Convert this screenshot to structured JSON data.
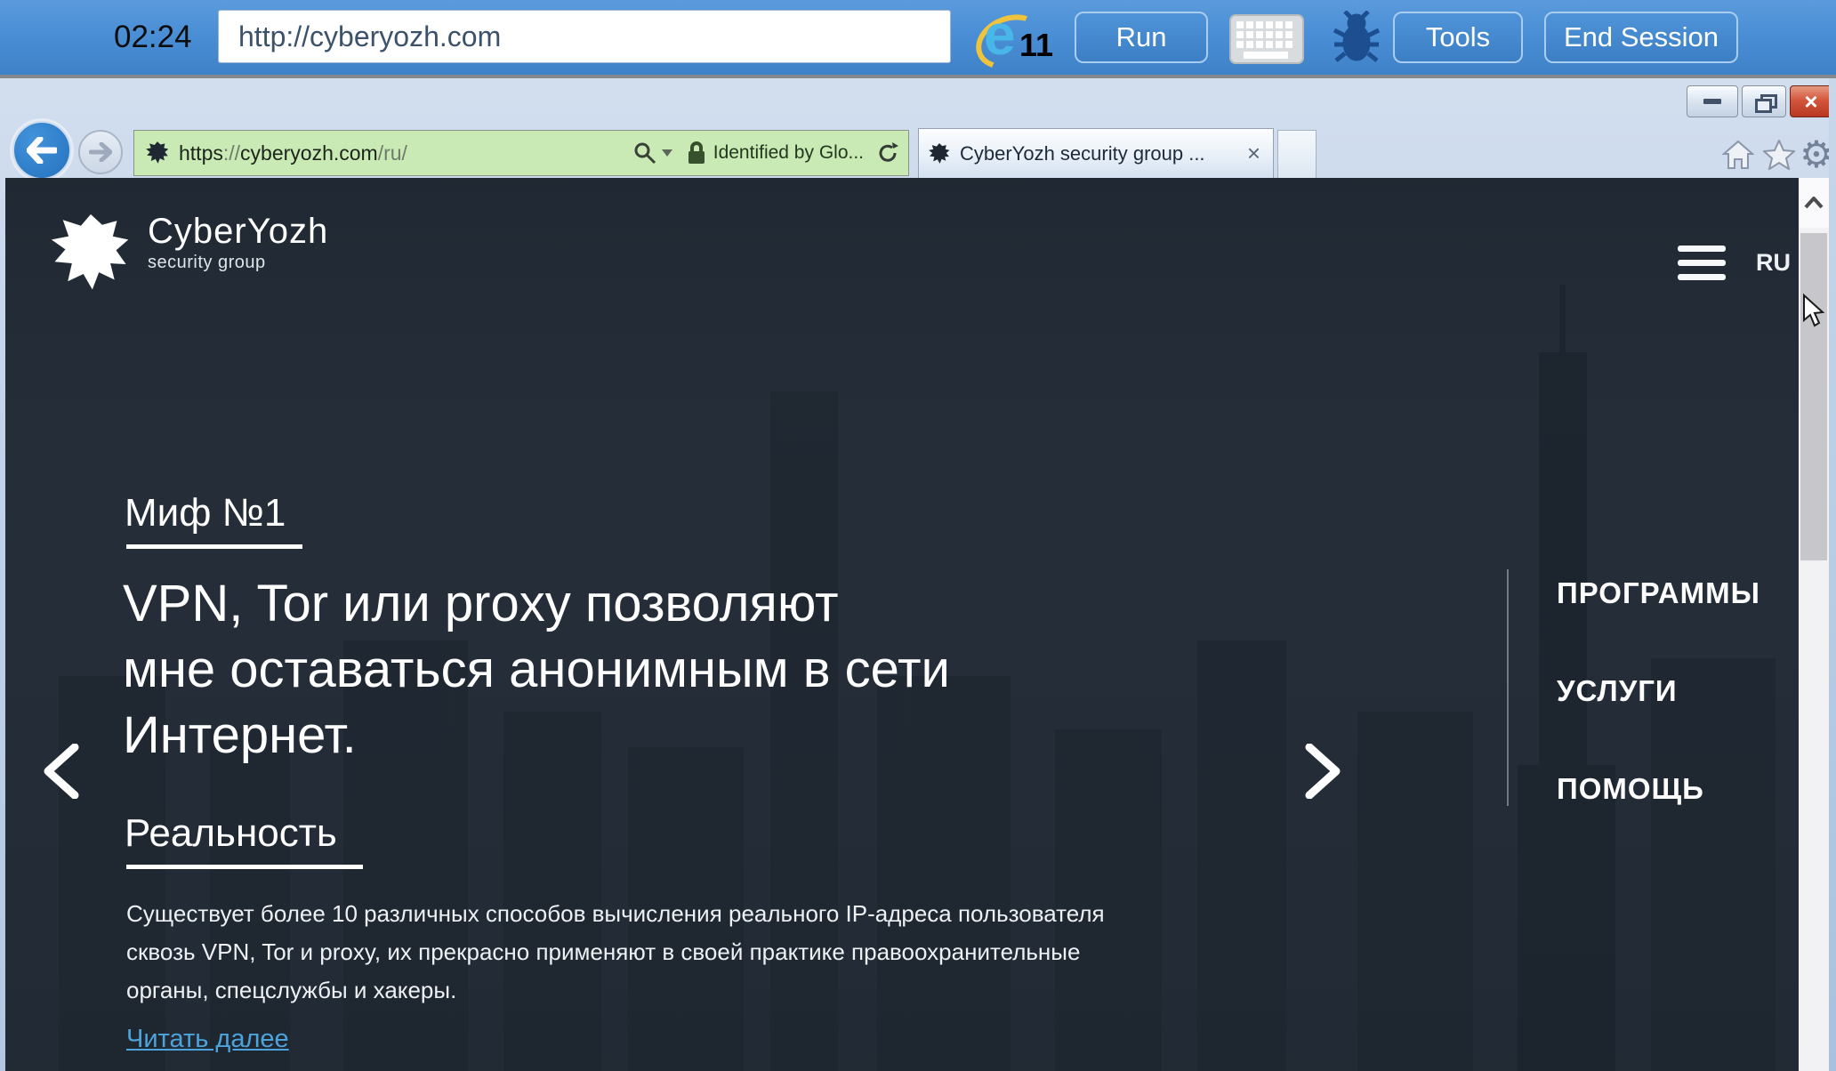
{
  "session_toolbar": {
    "timer": "02:24",
    "url_value": "http://cyberyozh.com",
    "ie_badge": "11",
    "run_label": "Run",
    "tools_label": "Tools",
    "end_session_label": "End Session"
  },
  "browser_chrome": {
    "address": {
      "scheme": "https",
      "separator": "://",
      "domain": "cyberyozh.com",
      "path": "/ru/",
      "full_url": "https://cyberyozh.com/ru/",
      "cert_label": "Identified by Glo..."
    },
    "tab": {
      "title": "CyberYozh security group ...",
      "close_glyph": "×"
    }
  },
  "page": {
    "logo_title": "CyberYozh",
    "logo_subtitle": "security group",
    "language": "RU",
    "slide": {
      "kicker": "Миф №1",
      "heading_line1": "VPN, Tor или proxy позволяют",
      "heading_line2": "мне оставаться анонимным в сети",
      "heading_line3": "Интернет.",
      "subheading": "Реальность",
      "body_line1": "Существует более 10 различных способов вычисления реального IP-адреса пользователя",
      "body_line2": "сквозь VPN, Tor и proxy, их прекрасно применяют в своей практике правоохранительные",
      "body_line3": "органы, спецслужбы и хакеры.",
      "read_more": "Читать далее"
    },
    "menu": {
      "item1": "ПРОГРАММЫ",
      "item2": "УСЛУГИ",
      "item3": "ПОМОЩЬ"
    }
  },
  "icons": {
    "gear_glyph": "⚙"
  },
  "colors": {
    "toolbar_blue": "#4a8ed5",
    "ev_green": "#c9eab5",
    "page_background": "#242d38",
    "link_blue": "#4da3dc",
    "close_red": "#c23b22"
  }
}
